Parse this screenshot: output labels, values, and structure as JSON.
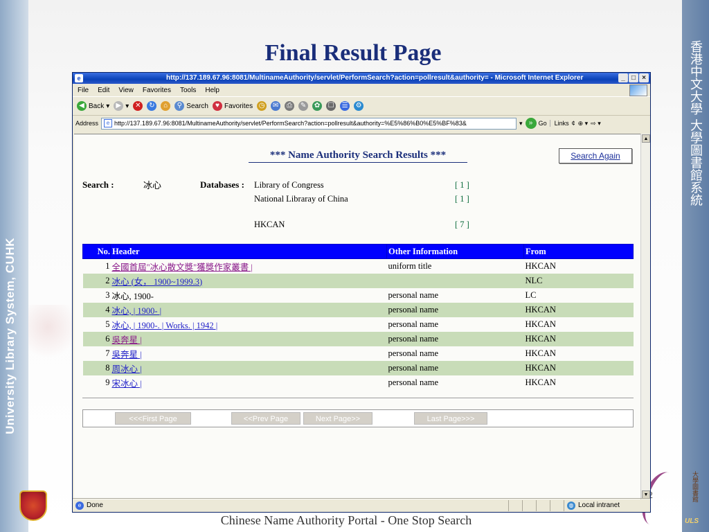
{
  "slide": {
    "title": "Final Result Page",
    "footer": "Chinese Name Authority Portal - One Stop Search",
    "page_number": "2",
    "left_vertical_text": "University Library System, CUHK",
    "right_vertical_text": "香港中文大學 大學圖書館系統",
    "logo_vertical_text": "大學圖書館",
    "logo_caption": "ULS"
  },
  "browser": {
    "title": "http://137.189.67.96:8081/MultinameAuthority/servlet/PerformSearch?action=pollresult&authority= - Microsoft Internet Explorer",
    "menu": [
      "File",
      "Edit",
      "View",
      "Favorites",
      "Tools",
      "Help"
    ],
    "toolbar": {
      "back": "Back",
      "search": "Search",
      "favorites": "Favorites"
    },
    "address": {
      "label": "Address",
      "url": "http://137.189.67.96:8081/MultinameAuthority/servlet/PerformSearch?action=pollresult&authority=%E5%86%B0%E5%BF%83&",
      "go": "Go",
      "links": "Links"
    },
    "status": {
      "text": "Done",
      "zone": "Local intranet"
    }
  },
  "page": {
    "results_title": "*** Name Authority Search Results ***",
    "search_again": "Search Again",
    "search_label": "Search :",
    "search_term": "冰心",
    "databases_label": "Databases :",
    "databases": [
      {
        "name": "Library of Congress",
        "count": "[ 1 ]"
      },
      {
        "name": "National Libraray of China",
        "count": "[ 1 ]"
      },
      {
        "name": "HKCAN",
        "count": "[ 7 ]"
      }
    ],
    "table": {
      "headers": [
        "No.",
        "Header",
        "Other Information",
        "From"
      ],
      "rows": [
        {
          "no": "1",
          "header": "全國首屆\"冰心散文獎\"獲獎作家叢書 |",
          "link": true,
          "visited": true,
          "other": "uniform title",
          "from": "HKCAN"
        },
        {
          "no": "2",
          "header": "冰心 (女， 1900~1999.3)",
          "link": true,
          "visited": false,
          "other": "",
          "from": "NLC"
        },
        {
          "no": "3",
          "header": "冰心, 1900-",
          "link": false,
          "visited": false,
          "other": "personal name",
          "from": "LC"
        },
        {
          "no": "4",
          "header": "冰心, | 1900- |",
          "link": true,
          "visited": false,
          "other": "personal name",
          "from": "HKCAN"
        },
        {
          "no": "5",
          "header": "冰心, | 1900-. | Works. | 1942 |",
          "link": true,
          "visited": false,
          "other": "personal name",
          "from": "HKCAN"
        },
        {
          "no": "6",
          "header": "吳奔星 |",
          "link": true,
          "visited": true,
          "other": "personal name",
          "from": "HKCAN"
        },
        {
          "no": "7",
          "header": "吳奔星 |",
          "link": true,
          "visited": false,
          "other": "personal name",
          "from": "HKCAN"
        },
        {
          "no": "8",
          "header": "周冰心 |",
          "link": true,
          "visited": false,
          "other": "personal name",
          "from": "HKCAN"
        },
        {
          "no": "9",
          "header": "宋冰心 |",
          "link": true,
          "visited": false,
          "other": "personal name",
          "from": "HKCAN"
        }
      ]
    },
    "pager": {
      "first": "<<<First Page",
      "prev": "<<Prev Page",
      "next": "Next Page>>",
      "last": "Last Page>>>"
    }
  },
  "colors": {
    "title_blue": "#1a2e7a",
    "table_header": "#0000ff",
    "alt_row": "#c8dcb8",
    "link": "#2020c8",
    "visited_link": "#8a1a8a"
  }
}
